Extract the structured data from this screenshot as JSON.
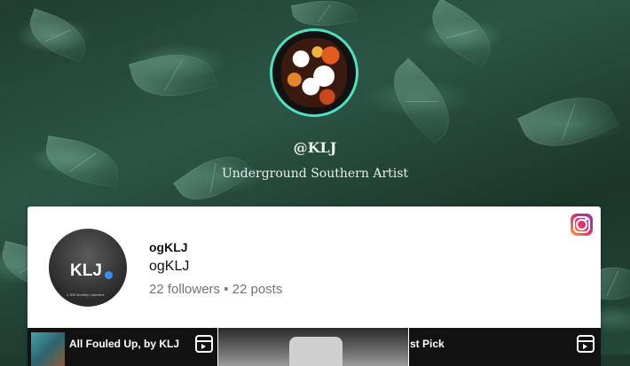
{
  "profile": {
    "handle": "@KLJ",
    "bio": "Underground Southern Artist"
  },
  "instagram": {
    "icon": "instagram-icon",
    "avatar_text": "KLJ",
    "avatar_subtext": "2,399 Monthly Listeners",
    "username": "ogKLJ",
    "name": "ogKLJ",
    "stats": "22 followers • 22 posts",
    "posts": [
      {
        "title": "All Fouled Up, by KLJ",
        "icon": "reels-icon"
      },
      {
        "title": "",
        "icon": ""
      },
      {
        "title": "st Pick",
        "icon": "reels-icon"
      }
    ]
  },
  "colors": {
    "avatar_ring": "#4fe0c0",
    "card_bg": "#ffffff",
    "stats_text": "#737373"
  }
}
